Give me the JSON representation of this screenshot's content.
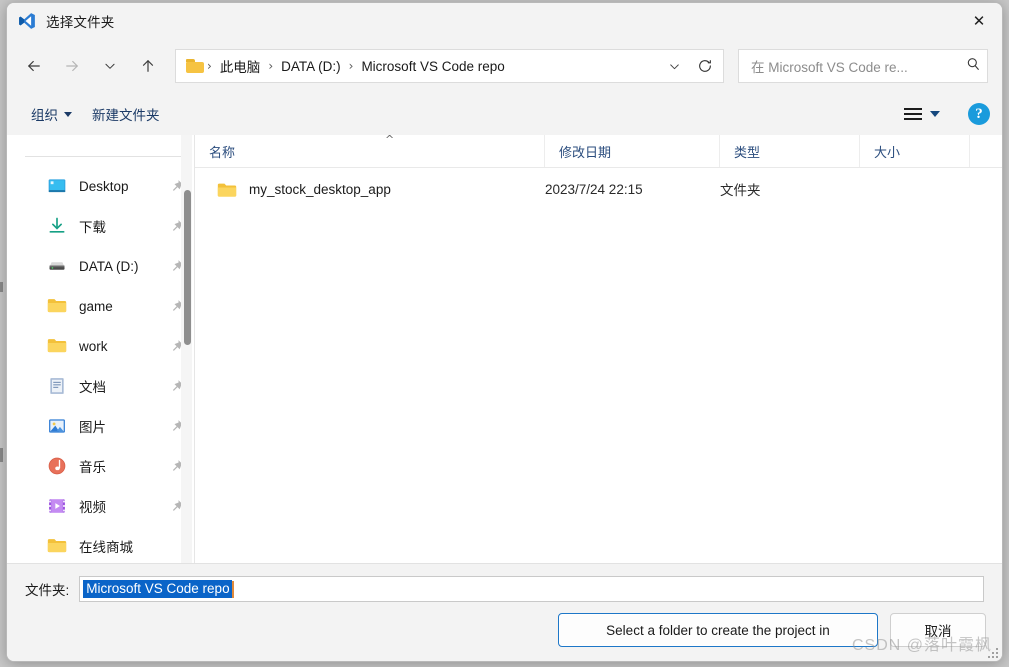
{
  "window": {
    "title": "选择文件夹",
    "title_icon": "vscode-icon",
    "close_label": "✕"
  },
  "nav": {
    "back_icon": "arrow-left-icon",
    "forward_icon": "arrow-right-icon",
    "recent_icon": "chevron-down-icon",
    "up_icon": "arrow-up-icon"
  },
  "address": {
    "folder_icon": "folder-icon",
    "separator": "›",
    "crumbs": [
      "此电脑",
      "DATA (D:)",
      "Microsoft VS Code repo"
    ],
    "dropdown_icon": "chevron-down-icon",
    "refresh_icon": "refresh-icon"
  },
  "search": {
    "placeholder": "在 Microsoft VS Code re...",
    "icon": "search-icon"
  },
  "toolbar": {
    "organize_label": "组织",
    "new_folder_label": "新建文件夹",
    "view_icon": "list-view-icon",
    "view_caret_icon": "caret-down-icon",
    "help_label": "?",
    "help_icon": "help-circle-icon"
  },
  "sidebar": {
    "items": [
      {
        "label": "Desktop",
        "icon": "desktop-icon",
        "pinned": true
      },
      {
        "label": "下载",
        "icon": "downloads-icon",
        "pinned": true
      },
      {
        "label": "DATA (D:)",
        "icon": "drive-icon",
        "pinned": true
      },
      {
        "label": "game",
        "icon": "folder-icon",
        "pinned": true
      },
      {
        "label": "work",
        "icon": "folder-icon",
        "pinned": true
      },
      {
        "label": "文档",
        "icon": "documents-icon",
        "pinned": true
      },
      {
        "label": "图片",
        "icon": "pictures-icon",
        "pinned": true
      },
      {
        "label": "音乐",
        "icon": "music-icon",
        "pinned": true
      },
      {
        "label": "视频",
        "icon": "videos-icon",
        "pinned": true
      },
      {
        "label": "在线商城",
        "icon": "folder-icon",
        "pinned": false
      }
    ],
    "scrollbar_icon": "scrollbar-thumb"
  },
  "filelist": {
    "columns": [
      {
        "key": "name",
        "label": "名称",
        "sort": "asc"
      },
      {
        "key": "date",
        "label": "修改日期",
        "sort": ""
      },
      {
        "key": "type",
        "label": "类型",
        "sort": ""
      },
      {
        "key": "size",
        "label": "大小",
        "sort": ""
      }
    ],
    "sort_indicator": "^",
    "rows": [
      {
        "name": "my_stock_desktop_app",
        "date": "2023/7/24 22:15",
        "type": "文件夹",
        "size": "",
        "icon": "folder-icon"
      }
    ]
  },
  "bottom": {
    "folder_label": "文件夹:",
    "folder_value": "Microsoft VS Code repo",
    "confirm_label": "Select a folder to create the project in",
    "cancel_label": "取消",
    "resize_grip_icon": "resize-grip-icon"
  },
  "watermark": {
    "text": "CSDN @落叶霞枫"
  },
  "colors": {
    "accent": "#0a64c8",
    "primary_border": "#1d77c8",
    "caret": "#e08a3c",
    "folder_yellow": "#f6c342",
    "help_blue": "#1a9bdc",
    "link_blue": "#1b3a66"
  }
}
